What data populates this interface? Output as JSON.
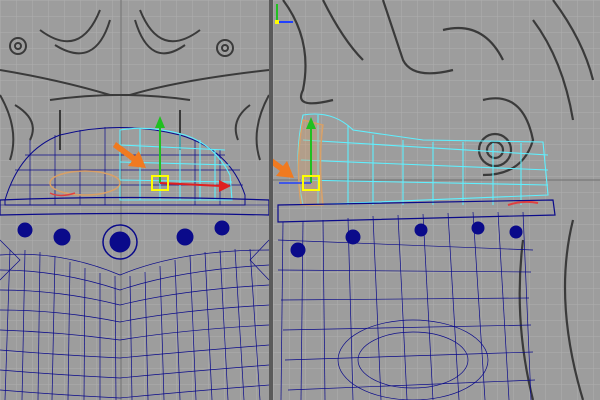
{
  "viewports": [
    {
      "id": "front",
      "view": "front"
    },
    {
      "id": "side",
      "view": "side"
    }
  ],
  "colors": {
    "viewport_bg": "#9d9d9d",
    "grid": "#b3b3b3",
    "sketch": "#3a3a3a",
    "wireframe": "#0a0a8a",
    "selection": "#5ff0ff",
    "highlight_face": "#d9a066",
    "annotation_arrow": "#f07a20",
    "axis_x": "#e02020",
    "axis_y": "#20c020",
    "axis_z": "#2040ff",
    "manipulator_center": "#ffff00"
  },
  "icons": {
    "annotation": "orange-arrow-icon",
    "manipulator": "move-manipulator-icon",
    "axis": "view-axis-icon"
  }
}
